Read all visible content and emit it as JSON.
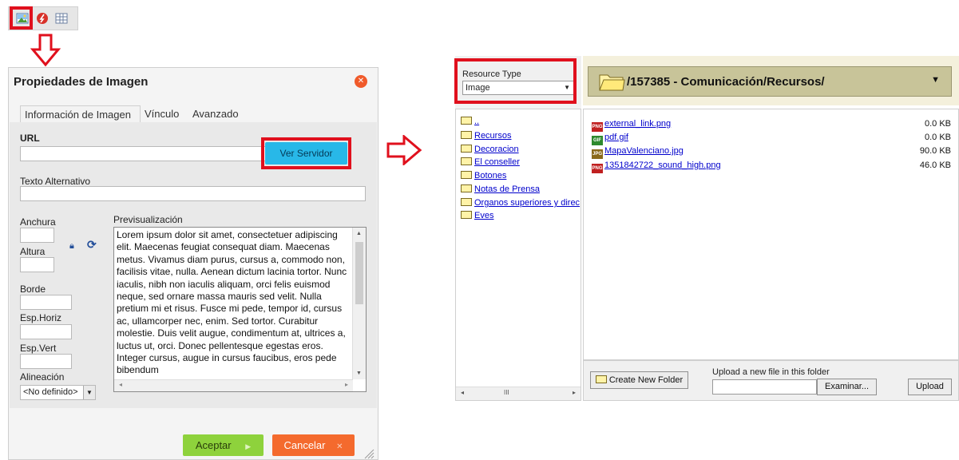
{
  "toolbar": {
    "icons": [
      "image-icon",
      "flash-icon",
      "table-icon"
    ],
    "highlight_color": "#e0101d"
  },
  "dialog": {
    "title": "Propiedades de Imagen",
    "tabs": [
      {
        "label": "Información de Imagen",
        "active": true
      },
      {
        "label": "Vínculo",
        "active": false
      },
      {
        "label": "Avanzado",
        "active": false
      }
    ],
    "url_label": "URL",
    "url_value": "",
    "browse_server_label": "Ver Servidor",
    "alt_text_label": "Texto Alternativo",
    "alt_text_value": "",
    "width_label": "Anchura",
    "height_label": "Altura",
    "border_label": "Borde",
    "hspace_label": "Esp.Horiz",
    "vspace_label": "Esp.Vert",
    "align_label": "Alineación",
    "align_value": "<No definido>",
    "preview_label": "Previsualización",
    "preview_text": "Lorem ipsum dolor sit amet, consectetuer adipiscing elit. Maecenas feugiat consequat diam. Maecenas metus. Vivamus diam purus, cursus a, commodo non, facilisis vitae, nulla. Aenean dictum lacinia tortor. Nunc iaculis, nibh non iaculis aliquam, orci felis euismod neque, sed ornare massa mauris sed velit. Nulla pretium mi et risus. Fusce mi pede, tempor id, cursus ac, ullamcorper nec, enim. Sed tortor. Curabitur molestie. Duis velit augue, condimentum at, ultrices a, luctus ut, orci. Donec pellentesque egestas eros. Integer cursus, augue in cursus faucibus, eros pede bibendum",
    "ok_label": "Aceptar",
    "cancel_label": "Cancelar",
    "ok_color": "#8ed23c",
    "cancel_color": "#f46a2d",
    "server_button_color": "#28b8e8"
  },
  "file_browser": {
    "resource_type_label": "Resource Type",
    "resource_type_value": "Image",
    "current_folder": "/157385 - Comunicación/Recursos/",
    "folders": [
      "..",
      "Recursos",
      "Decoracion",
      "El conseller",
      "Botones",
      "Notas de Prensa",
      "Organos superiores y direc",
      "Eves"
    ],
    "files": [
      {
        "name": "external_link.png",
        "size": "0.0 KB",
        "icon": "png-icon"
      },
      {
        "name": "pdf.gif",
        "size": "0.0 KB",
        "icon": "gif-icon"
      },
      {
        "name": "MapaValenciano.jpg",
        "size": "90.0 KB",
        "icon": "jpg-icon"
      },
      {
        "name": "1351842722_sound_high.png",
        "size": "46.0 KB",
        "icon": "png-icon"
      }
    ],
    "create_folder_label": "Create New Folder",
    "upload_hint": "Upload a new file in this folder",
    "browse_label": "Examinar...",
    "upload_label": "Upload",
    "hscroll_glyph": "III"
  }
}
